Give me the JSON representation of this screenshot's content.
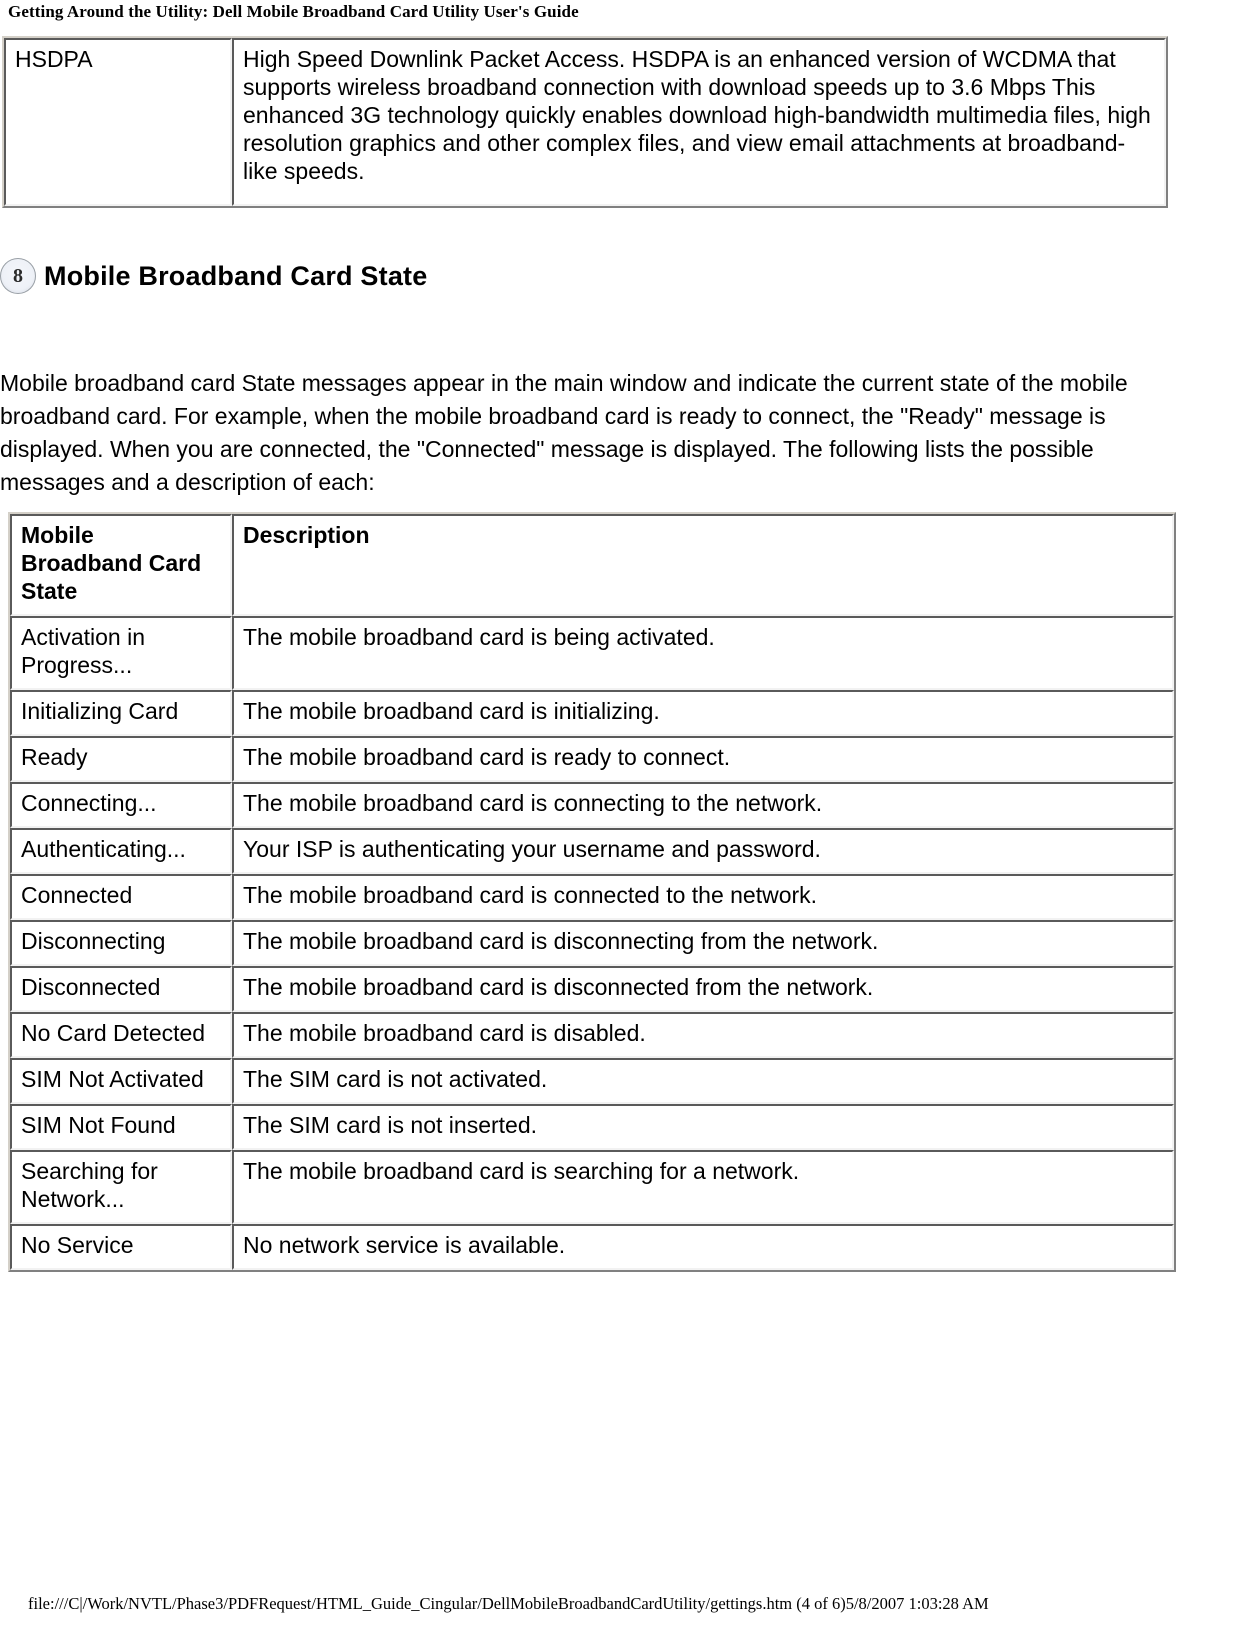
{
  "page": {
    "header_title": "Getting Around the Utility: Dell Mobile Broadband Card Utility User's Guide",
    "footer_path": "file:///C|/Work/NVTL/Phase3/PDFRequest/HTML_Guide_Cingular/DellMobileBroadbandCardUtility/gettings.htm (4 of 6)5/8/2007 1:03:28 AM"
  },
  "hsdpa_table": {
    "term": "HSDPA",
    "definition": "High Speed Downlink Packet Access. HSDPA is an enhanced version of WCDMA that supports wireless broadband connection with download speeds up to 3.6 Mbps This enhanced 3G technology quickly enables download high-bandwidth multimedia files, high resolution graphics and other complex files, and view email attachments at broadband-like speeds."
  },
  "section": {
    "badge_number": "8",
    "title": "Mobile Broadband Card State",
    "intro": "Mobile broadband card State messages appear in the main window and indicate the current state of the mobile broadband card. For example, when the mobile broadband card is ready to connect, the \"Ready\" message is displayed. When you are connected, the \"Connected\" message is displayed. The following lists the possible messages and a description of each:"
  },
  "card_state_table": {
    "columns": [
      "Mobile Broadband Card State",
      "Description"
    ],
    "rows": [
      {
        "state": "Activation in Progress...",
        "description": "The mobile broadband card is being activated."
      },
      {
        "state": "Initializing Card",
        "description": "The mobile broadband card is initializing."
      },
      {
        "state": "Ready",
        "description": "The mobile broadband card is ready to connect."
      },
      {
        "state": "Connecting...",
        "description": "The mobile broadband card is connecting to the network."
      },
      {
        "state": "Authenticating...",
        "description": "Your ISP is authenticating your username and password."
      },
      {
        "state": "Connected",
        "description": "The mobile broadband card is connected to the network."
      },
      {
        "state": "Disconnecting",
        "description": "The mobile broadband card is disconnecting from the network."
      },
      {
        "state": "Disconnected",
        "description": "The mobile broadband card is disconnected from the network."
      },
      {
        "state": "No Card Detected",
        "description": "The mobile broadband card is disabled."
      },
      {
        "state": "SIM Not Activated",
        "description": "The SIM card is not activated."
      },
      {
        "state": "SIM Not Found",
        "description": "The SIM card is not inserted."
      },
      {
        "state": "Searching for Network...",
        "description": "The mobile broadband card is searching for a network."
      },
      {
        "state": "No Service",
        "description": "No network service is available."
      }
    ]
  }
}
